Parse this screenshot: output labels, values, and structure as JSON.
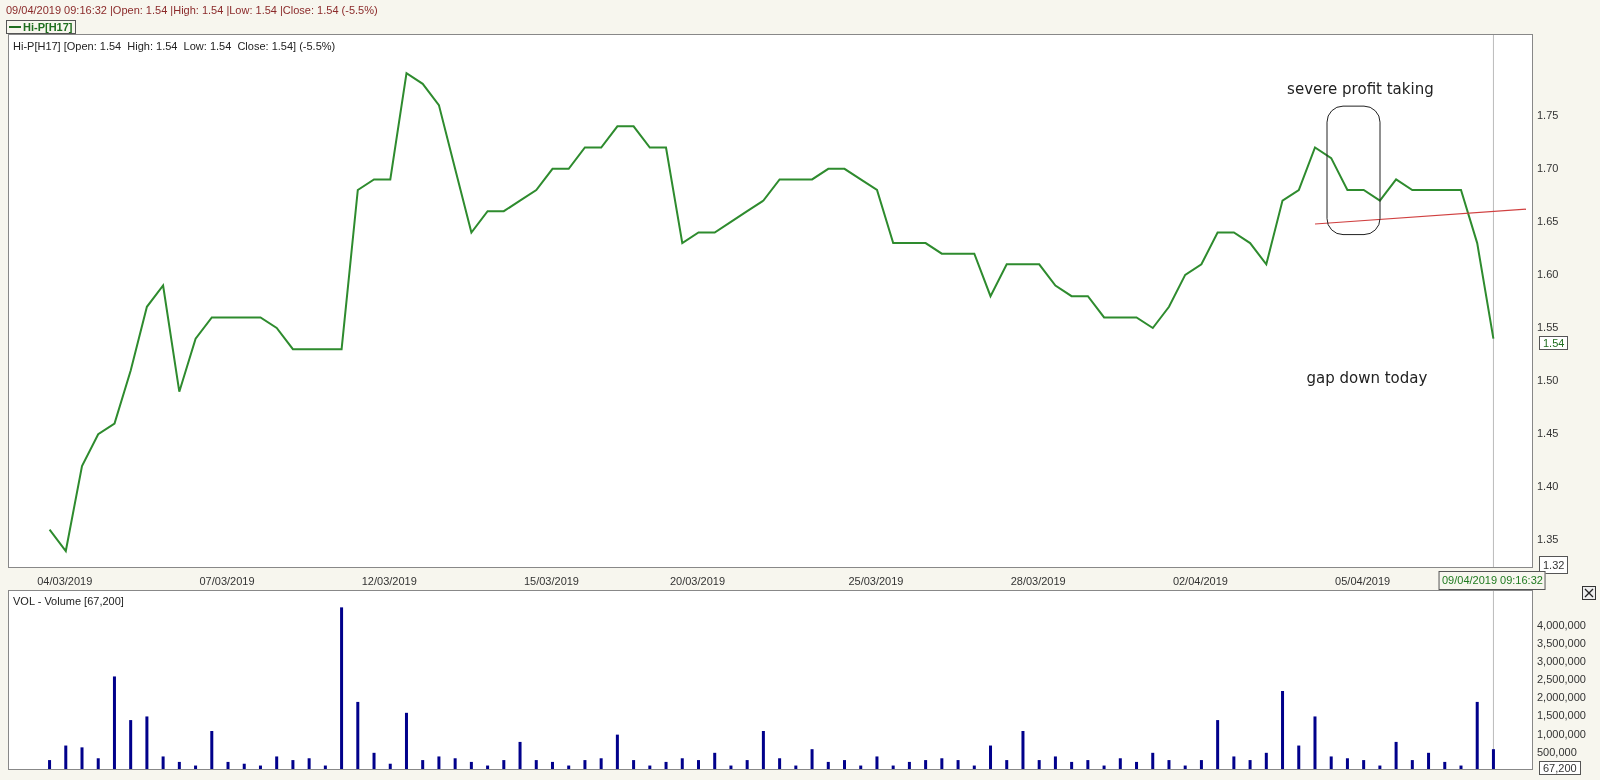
{
  "header": {
    "quote_line": "09/04/2019 09:16:32 |Open: 1.54 |High: 1.54 |Low: 1.54 |Close: 1.54 (-5.5%)",
    "legend": "Hi-P[H17]"
  },
  "price_panel": {
    "title": "Hi-P[H17] [Open: 1.54  High: 1.54  Low: 1.54  Close: 1.54] (-5.5%)",
    "axis_min_label": "1.32",
    "last_price_label": "1.54",
    "cursor_time_label": "09/04/2019 09:16:32",
    "chart_data": {
      "type": "line",
      "ylim": [
        1.323,
        1.826
      ],
      "categories": [
        null,
        null,
        null,
        "04/03/2019",
        null,
        null,
        null,
        null,
        null,
        null,
        null,
        null,
        null,
        "07/03/2019",
        null,
        null,
        null,
        null,
        null,
        null,
        null,
        null,
        null,
        "12/03/2019",
        null,
        null,
        null,
        null,
        null,
        null,
        null,
        null,
        null,
        "15/03/2019",
        null,
        null,
        null,
        null,
        null,
        null,
        null,
        null,
        "20/03/2019",
        null,
        null,
        null,
        null,
        null,
        null,
        null,
        null,
        null,
        null,
        "25/03/2019",
        null,
        null,
        null,
        null,
        null,
        null,
        null,
        null,
        null,
        "28/03/2019",
        null,
        null,
        null,
        null,
        null,
        null,
        null,
        null,
        null,
        "02/04/2019",
        null,
        null,
        null,
        null,
        null,
        null,
        null,
        null,
        null,
        "05/04/2019",
        null,
        null,
        null,
        null,
        null,
        null,
        null,
        null,
        null,
        null
      ],
      "yticks": [
        {
          "value": 1.35,
          "label": "1.35"
        },
        {
          "value": 1.4,
          "label": "1.40"
        },
        {
          "value": 1.45,
          "label": "1.45"
        },
        {
          "value": 1.5,
          "label": "1.50"
        },
        {
          "value": 1.55,
          "label": "1.55"
        },
        {
          "value": 1.6,
          "label": "1.60"
        },
        {
          "value": 1.65,
          "label": "1.65"
        },
        {
          "value": 1.7,
          "label": "1.70"
        },
        {
          "value": 1.75,
          "label": "1.75"
        }
      ],
      "series": [
        {
          "color": "#2e8b2e",
          "values": [
            null,
            null,
            1.36,
            1.34,
            1.42,
            1.45,
            1.46,
            1.51,
            1.57,
            1.59,
            1.49,
            1.54,
            1.56,
            1.56,
            1.56,
            1.56,
            1.55,
            1.53,
            1.53,
            1.53,
            1.53,
            1.68,
            1.69,
            1.69,
            1.79,
            1.78,
            1.76,
            1.7,
            1.64,
            1.66,
            1.66,
            1.67,
            1.68,
            1.7,
            1.7,
            1.72,
            1.72,
            1.74,
            1.74,
            1.72,
            1.72,
            1.63,
            1.64,
            1.64,
            1.65,
            1.66,
            1.67,
            1.69,
            1.69,
            1.69,
            1.7,
            1.7,
            1.69,
            1.68,
            1.63,
            1.63,
            1.63,
            1.62,
            1.62,
            1.62,
            1.58,
            1.61,
            1.61,
            1.61,
            1.59,
            1.58,
            1.58,
            1.56,
            1.56,
            1.56,
            1.55,
            1.57,
            1.6,
            1.61,
            1.64,
            1.64,
            1.63,
            1.61,
            1.67,
            1.68,
            1.72,
            1.71,
            1.68,
            1.68,
            1.67,
            1.69,
            1.68,
            1.68,
            1.68,
            1.68,
            1.63,
            1.54,
            null,
            null
          ]
        },
        {
          "color": "#d04040",
          "values": [
            null,
            null,
            null,
            null,
            null,
            null,
            null,
            null,
            null,
            null,
            null,
            null,
            null,
            null,
            null,
            null,
            null,
            null,
            null,
            null,
            null,
            null,
            null,
            null,
            null,
            null,
            null,
            null,
            null,
            null,
            null,
            null,
            null,
            null,
            null,
            null,
            null,
            null,
            null,
            null,
            null,
            null,
            null,
            null,
            null,
            null,
            null,
            null,
            null,
            null,
            null,
            null,
            null,
            null,
            null,
            null,
            null,
            null,
            null,
            null,
            null,
            null,
            null,
            null,
            null,
            null,
            null,
            null,
            null,
            null,
            null,
            null,
            null,
            null,
            null,
            null,
            null,
            null,
            null,
            null,
            1.648,
            null,
            null,
            null,
            null,
            null,
            null,
            null,
            null,
            null,
            null,
            null,
            null,
            1.662
          ]
        }
      ],
      "annotations": [
        {
          "text": "severe profit taking"
        },
        {
          "text": "gap down today"
        }
      ]
    }
  },
  "volume_panel": {
    "title": "VOL - Volume [67,200]",
    "last_volume_label": "67,200",
    "chart_data": {
      "type": "bar",
      "ylim": [
        0,
        4950000
      ],
      "yticks": [
        {
          "value": 500000,
          "label": "500,000"
        },
        {
          "value": 1000000,
          "label": "1,000,000"
        },
        {
          "value": 1500000,
          "label": "1,500,000"
        },
        {
          "value": 2000000,
          "label": "2,000,000"
        },
        {
          "value": 2500000,
          "label": "2,500,000"
        },
        {
          "value": 3000000,
          "label": "3,000,000"
        },
        {
          "value": 3500000,
          "label": "3,500,000"
        },
        {
          "value": 4000000,
          "label": "4,000,000"
        }
      ],
      "series": [
        {
          "color": "#00008b",
          "values": [
            null,
            null,
            300000,
            700000,
            650000,
            350000,
            2600000,
            1400000,
            1500000,
            400000,
            250000,
            150000,
            1100000,
            250000,
            200000,
            150000,
            400000,
            300000,
            350000,
            150000,
            4500000,
            1900000,
            500000,
            200000,
            1600000,
            300000,
            400000,
            350000,
            250000,
            150000,
            300000,
            800000,
            300000,
            250000,
            150000,
            300000,
            350000,
            1000000,
            300000,
            150000,
            250000,
            350000,
            300000,
            500000,
            150000,
            300000,
            1100000,
            350000,
            150000,
            600000,
            250000,
            300000,
            150000,
            400000,
            150000,
            250000,
            300000,
            350000,
            300000,
            150000,
            700000,
            300000,
            1100000,
            300000,
            400000,
            250000,
            300000,
            150000,
            350000,
            250000,
            500000,
            300000,
            150000,
            300000,
            1400000,
            400000,
            300000,
            500000,
            2200000,
            700000,
            1500000,
            400000,
            350000,
            300000,
            150000,
            800000,
            300000,
            500000,
            250000,
            150000,
            1900000,
            600000,
            null,
            null
          ]
        }
      ]
    }
  }
}
